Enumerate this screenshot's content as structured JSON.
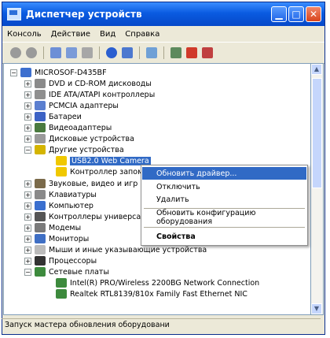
{
  "window": {
    "title": "Диспетчер устройств"
  },
  "menu": [
    "Консоль",
    "Действие",
    "Вид",
    "Справка"
  ],
  "tree": {
    "root": "MICROSOF-D435BF",
    "items": [
      {
        "label": "DVD и CD-ROM дисководы",
        "icon": "cdrom-icon",
        "color": "#8a8a8a"
      },
      {
        "label": "IDE ATA/ATAPI контроллеры",
        "icon": "ide-controller-icon",
        "color": "#8f8f8f"
      },
      {
        "label": "PCMCIA адаптеры",
        "icon": "pcmcia-icon",
        "color": "#5b7fd0"
      },
      {
        "label": "Батареи",
        "icon": "battery-icon",
        "color": "#3c62c5"
      },
      {
        "label": "Видеоадаптеры",
        "icon": "display-adapter-icon",
        "color": "#4a7a3f"
      },
      {
        "label": "Дисковые устройства",
        "icon": "disk-drive-icon",
        "color": "#9a9a9a"
      },
      {
        "label": "Другие устройства",
        "icon": "unknown-device-icon",
        "color": "#d4b400"
      },
      {
        "label": "USB2.0 Web Camera",
        "icon": "warning-device-icon",
        "color": "#f0c800"
      },
      {
        "label": "Контроллер запом",
        "icon": "warning-device-icon",
        "color": "#f0c800"
      },
      {
        "label": "Звуковые, видео и игр",
        "icon": "sound-icon",
        "color": "#7a6a4a"
      },
      {
        "label": "Клавиатуры",
        "icon": "keyboard-icon",
        "color": "#8a8a8a"
      },
      {
        "label": "Компьютер",
        "icon": "computer-icon",
        "color": "#3a6fcf"
      },
      {
        "label": "Контроллеры универса",
        "icon": "usb-icon",
        "color": "#555555"
      },
      {
        "label": "Модемы",
        "icon": "modem-icon",
        "color": "#7a7a7a"
      },
      {
        "label": "Мониторы",
        "icon": "monitor-icon",
        "color": "#3f6fc4"
      },
      {
        "label": "Мыши и иные указывающие устройства",
        "icon": "mouse-icon",
        "color": "#bbbbbb"
      },
      {
        "label": "Процессоры",
        "icon": "processor-icon",
        "color": "#333333"
      },
      {
        "label": "Сетевые платы",
        "icon": "network-icon",
        "color": "#3d8a3d"
      },
      {
        "label": "Intel(R) PRO/Wireless 2200BG Network Connection",
        "icon": "network-card-icon",
        "color": "#3d8a3d"
      },
      {
        "label": "Realtek RTL8139/810x Family Fast Ethernet NIC",
        "icon": "network-card-icon",
        "color": "#3d8a3d"
      }
    ]
  },
  "context_menu": {
    "update_driver": "Обновить драйвер...",
    "disable": "Отключить",
    "uninstall": "Удалить",
    "scan_hardware": "Обновить конфигурацию оборудования",
    "properties": "Свойства"
  },
  "status": "Запуск мастера обновления оборудовани",
  "colors": {
    "title_bar": "#0a5be1",
    "selection": "#316ac5"
  }
}
